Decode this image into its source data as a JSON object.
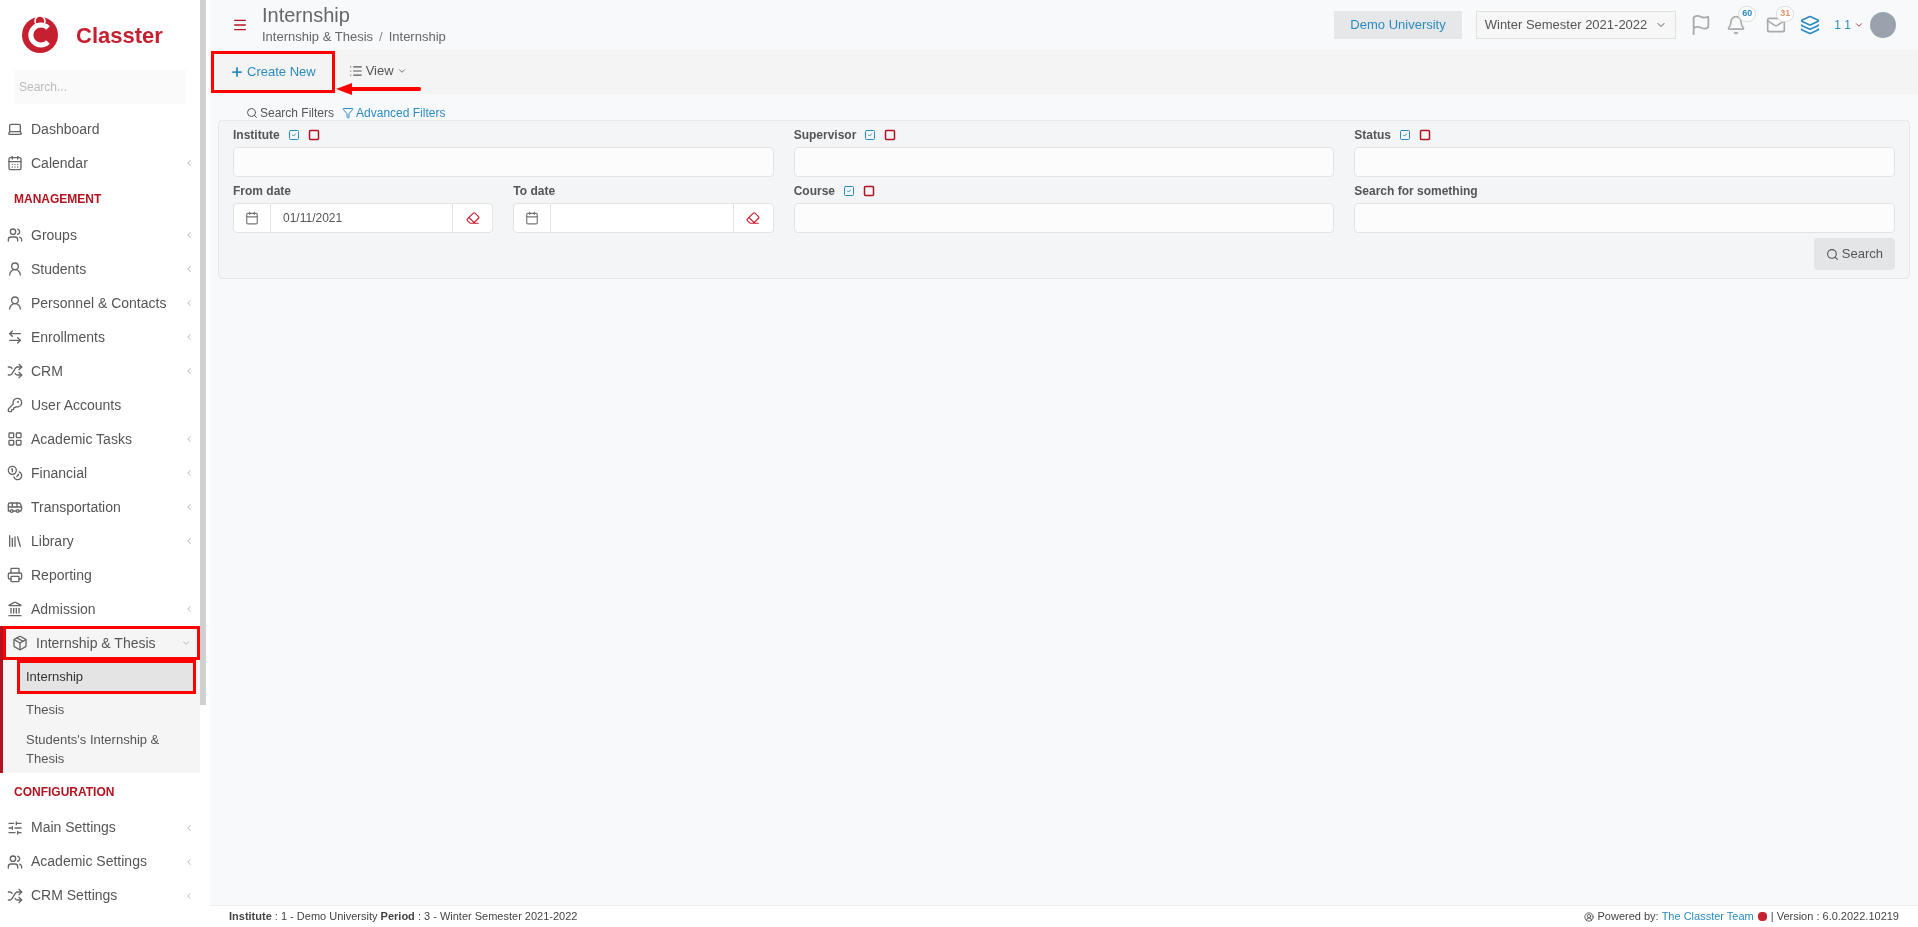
{
  "brand": {
    "name": "Classter"
  },
  "sidebar": {
    "search": {
      "placeholder": "Search..."
    },
    "sections": [
      {
        "items": [
          {
            "label": "Dashboard",
            "expandable": false
          },
          {
            "label": "Calendar",
            "expandable": true
          }
        ]
      },
      {
        "title": "MANAGEMENT",
        "items": [
          {
            "label": "Groups",
            "expandable": true
          },
          {
            "label": "Students",
            "expandable": true
          },
          {
            "label": "Personnel & Contacts",
            "expandable": true
          },
          {
            "label": "Enrollments",
            "expandable": true
          },
          {
            "label": "CRM",
            "expandable": true
          },
          {
            "label": "User Accounts",
            "expandable": false
          },
          {
            "label": "Academic Tasks",
            "expandable": true
          },
          {
            "label": "Financial",
            "expandable": true
          },
          {
            "label": "Transportation",
            "expandable": true
          },
          {
            "label": "Library",
            "expandable": true
          },
          {
            "label": "Reporting",
            "expandable": false
          },
          {
            "label": "Admission",
            "expandable": true
          },
          {
            "label": "Internship & Thesis",
            "expandable": true,
            "expanded": true,
            "highlighted": true,
            "children": [
              {
                "label": "Internship",
                "selected": true,
                "highlighted": true
              },
              {
                "label": "Thesis",
                "selected": false,
                "highlighted": false
              },
              {
                "label": "Students's Internship & Thesis",
                "selected": false,
                "highlighted": false
              }
            ]
          }
        ]
      },
      {
        "title": "CONFIGURATION",
        "items": [
          {
            "label": "Main Settings",
            "expandable": true
          },
          {
            "label": "Academic Settings",
            "expandable": true
          },
          {
            "label": "CRM Settings",
            "expandable": true
          }
        ]
      }
    ]
  },
  "header": {
    "title": "Internship",
    "breadcrumb": [
      "Internship & Thesis",
      "Internship"
    ],
    "breadcrumb_separator": "/",
    "institution": "Demo University",
    "period": "Winter Semester 2021-2022",
    "notifications": "60",
    "messages": "31",
    "user": "1 1"
  },
  "toolbar": {
    "create": {
      "label": "Create New",
      "highlighted": true,
      "pointer_arrow": true
    },
    "view": {
      "label": "View"
    }
  },
  "filters": {
    "tabs": [
      {
        "label": "Search Filters",
        "kind": "search"
      },
      {
        "label": "Advanced Filters",
        "kind": "filter"
      }
    ],
    "fields": [
      {
        "label": "Institute",
        "kind": "text",
        "select_toggles": true
      },
      {
        "label": "Supervisor",
        "kind": "text",
        "select_toggles": true
      },
      {
        "label": "Status",
        "kind": "text",
        "select_toggles": true
      },
      {
        "label": "From date",
        "kind": "date",
        "select_toggles": false,
        "value": "01/11/2021"
      },
      {
        "label": "To date",
        "kind": "date",
        "select_toggles": false
      },
      {
        "label": "Course",
        "kind": "text",
        "select_toggles": true
      },
      {
        "label": "Search for something",
        "kind": "text",
        "select_toggles": false
      }
    ],
    "search_button": "Search"
  },
  "footer": {
    "info": "**Institute** : 1 - Demo University **Period** : 3 - Winter Semester 2021-2022",
    "powered_by": "Powered by:",
    "team_link": "The Classter Team",
    "version": "| Version : 6.0.2022.10219"
  }
}
